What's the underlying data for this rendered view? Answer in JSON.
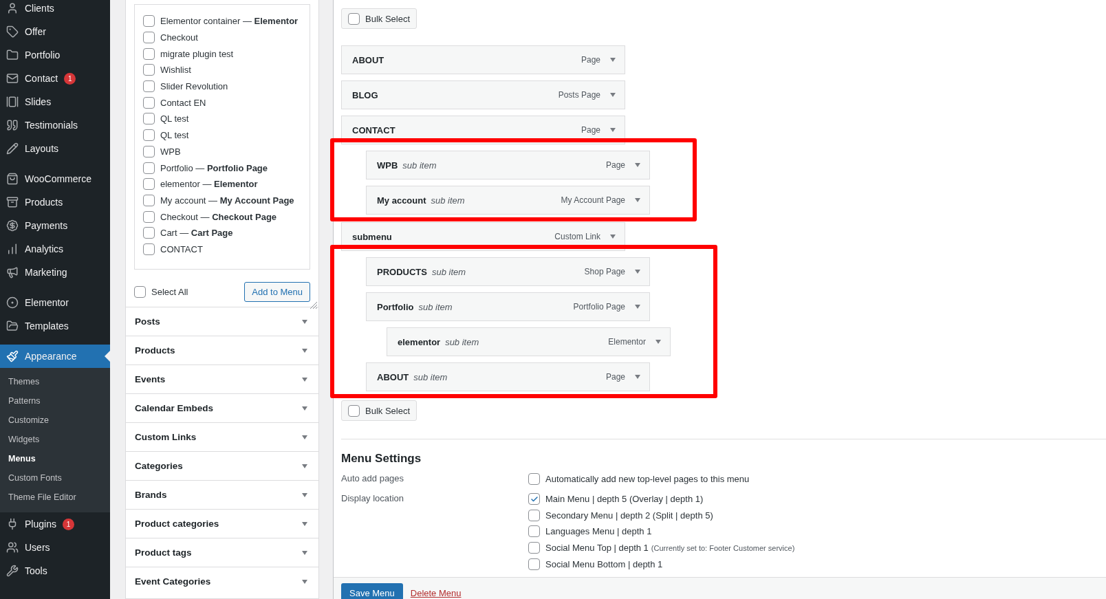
{
  "admin_menu": [
    {
      "label": "Clients",
      "selected": false
    },
    {
      "label": "Offer",
      "selected": false
    },
    {
      "label": "Portfolio",
      "selected": false
    },
    {
      "label": "Contact",
      "badge": "1",
      "selected": false
    },
    {
      "label": "Slides",
      "selected": false
    },
    {
      "label": "Testimonials",
      "selected": false
    },
    {
      "label": "Layouts",
      "selected": false
    },
    {
      "label": "WooCommerce",
      "separator_before": true,
      "selected": false
    },
    {
      "label": "Products",
      "selected": false
    },
    {
      "label": "Payments",
      "selected": false
    },
    {
      "label": "Analytics",
      "selected": false
    },
    {
      "label": "Marketing",
      "selected": false
    },
    {
      "label": "Elementor",
      "separator_before": true,
      "selected": false
    },
    {
      "label": "Templates",
      "selected": false
    },
    {
      "label": "Appearance",
      "separator_before": true,
      "selected": true,
      "children": [
        {
          "label": "Themes",
          "selected": false
        },
        {
          "label": "Patterns",
          "selected": false
        },
        {
          "label": "Customize",
          "selected": false
        },
        {
          "label": "Widgets",
          "selected": false
        },
        {
          "label": "Menus",
          "selected": true
        },
        {
          "label": "Custom Fonts",
          "selected": false
        },
        {
          "label": "Theme File Editor",
          "selected": false
        }
      ]
    },
    {
      "label": "Plugins",
      "badge": "1",
      "selected": false
    },
    {
      "label": "Users",
      "selected": false
    },
    {
      "label": "Tools",
      "selected": false
    }
  ],
  "pages_panel": {
    "items": [
      {
        "label": "Elementor container — **Elementor**",
        "checked": false
      },
      {
        "label": "Checkout",
        "checked": false
      },
      {
        "label": "migrate plugin test",
        "checked": false
      },
      {
        "label": "Wishlist",
        "checked": false
      },
      {
        "label": "Slider Revolution",
        "checked": false
      },
      {
        "label": "Contact EN",
        "checked": false
      },
      {
        "label": "QL test",
        "checked": false
      },
      {
        "label": "QL test",
        "checked": false
      },
      {
        "label": "WPB",
        "checked": false
      },
      {
        "label": "Portfolio — **Portfolio Page**",
        "checked": false
      },
      {
        "label": "elementor — **Elementor**",
        "checked": false
      },
      {
        "label": "My account — **My Account Page**",
        "checked": false
      },
      {
        "label": "Checkout — **Checkout Page**",
        "checked": false
      },
      {
        "label": "Cart — **Cart Page**",
        "checked": false
      },
      {
        "label": "CONTACT",
        "checked": false
      }
    ],
    "select_all": {
      "label": "Select All",
      "checked": false
    },
    "add_button": "Add to Menu"
  },
  "sections": [
    "Posts",
    "Products",
    "Events",
    "Calendar Embeds",
    "Custom Links",
    "Categories",
    "Brands",
    "Product categories",
    "Product tags",
    "Event Categories"
  ],
  "bulk_select_top": {
    "label": "Bulk Select",
    "checked": false
  },
  "menu_items": [
    {
      "title": "ABOUT",
      "type": "Page"
    },
    {
      "title": "BLOG",
      "type": "Posts Page"
    },
    {
      "title": "CONTACT",
      "type": "Page",
      "children_framed": true,
      "children": [
        {
          "title": "WPB",
          "note": "sub item",
          "type": "Page"
        },
        {
          "title": "My account",
          "note": "sub item",
          "type": "My Account Page"
        }
      ]
    },
    {
      "title": "submenu",
      "type": "Custom Link",
      "children_framed": true,
      "children": [
        {
          "title": "PRODUCTS",
          "note": "sub item",
          "type": "Shop Page"
        },
        {
          "title": "Portfolio",
          "note": "sub item",
          "type": "Portfolio Page",
          "children": [
            {
              "title": "elementor",
              "note": "sub item",
              "type": "Elementor"
            }
          ]
        },
        {
          "title": "ABOUT",
          "note": "sub item",
          "type": "Page"
        }
      ]
    }
  ],
  "bulk_select_bottom": {
    "label": "Bulk Select",
    "checked": false
  },
  "menu_settings": {
    "heading": "Menu Settings",
    "auto_add": {
      "label": "Auto add pages",
      "options": [
        {
          "label": "Automatically add new top-level pages to this menu",
          "checked": false
        }
      ]
    },
    "display_location": {
      "label": "Display location",
      "options": [
        {
          "label": "Main Menu | depth 5 (Overlay | depth 1)",
          "checked": true
        },
        {
          "label": "Secondary Menu | depth 2 (Split | depth 5)",
          "checked": false
        },
        {
          "label": "Languages Menu | depth 1",
          "checked": false
        },
        {
          "label": "Social Menu Top | depth 1",
          "note": "(Currently set to: Footer Customer service)",
          "checked": false
        },
        {
          "label": "Social Menu Bottom | depth 1",
          "checked": false
        }
      ]
    }
  },
  "footer": {
    "save": "Save Menu",
    "delete": "Delete Menu"
  }
}
